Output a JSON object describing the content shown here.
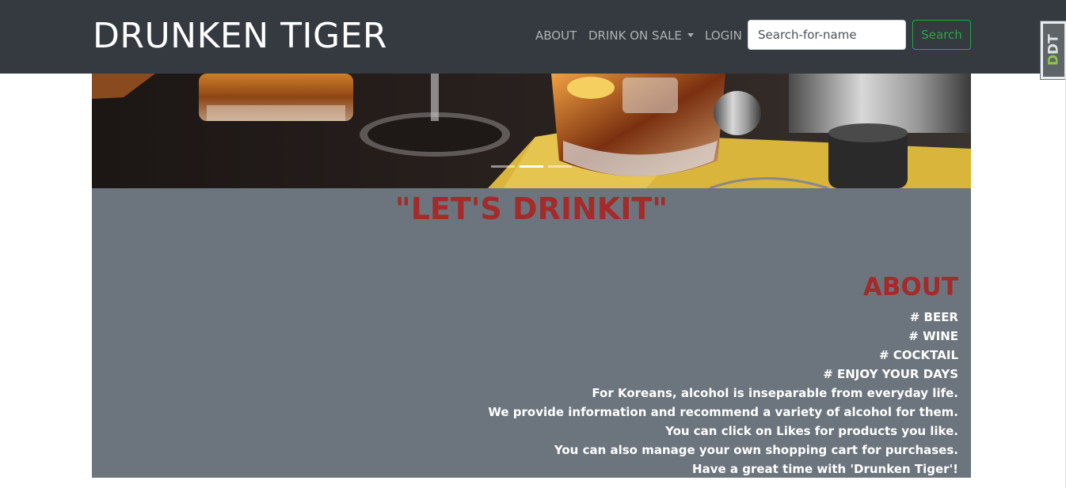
{
  "navbar": {
    "brand": "DRUNKEN TIGER",
    "links": [
      {
        "label": "ABOUT"
      },
      {
        "label": "DRINK ON SALE"
      },
      {
        "label": "LOGIN"
      }
    ],
    "search": {
      "placeholder": "Search-for-name",
      "value": ""
    },
    "search_button": "Search"
  },
  "extension_badge": {
    "text_a": "D",
    "text_b": "DT",
    "icon": "ddt-extension-icon"
  },
  "carousel": {
    "indicator_count": 3,
    "active_index": 1
  },
  "main": {
    "slogan": "\"LET'S DRINKIT\"",
    "about": {
      "title": "ABOUT",
      "lines": [
        "# BEER",
        "# WINE",
        "# COCKTAIL",
        "# ENJOY YOUR DAYS",
        "For Koreans, alcohol is inseparable from everyday life.",
        "We provide information and recommend a variety of alcohol for them.",
        "You can click on Likes for products you like.",
        "You can also manage your own shopping cart for purchases.",
        "Have a great time with 'Drunken Tiger'!"
      ]
    }
  },
  "colors": {
    "navbar_bg": "#343a40",
    "content_bg": "#6c757d",
    "accent_red": "#a52a2a",
    "success_green": "#28a745"
  }
}
